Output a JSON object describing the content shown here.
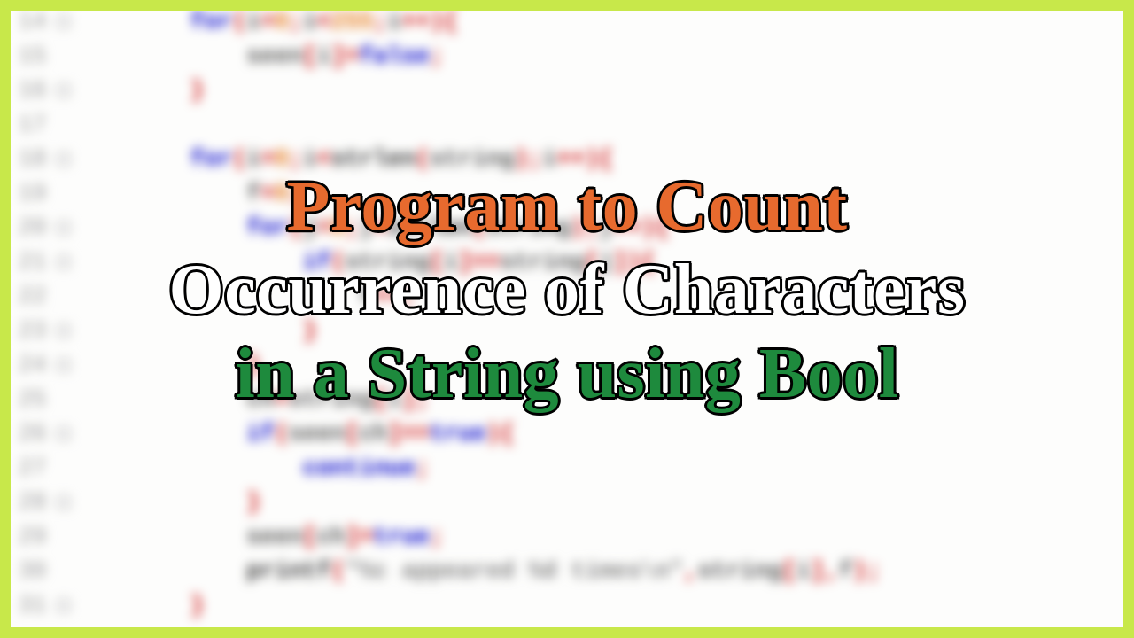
{
  "title": {
    "line1": "Program to Count",
    "line2": "Occurrence of Characters",
    "line3": "in a String using Bool"
  },
  "code": {
    "lines": [
      {
        "n": 14,
        "mark": true,
        "tokens": [
          [
            "",
            "        "
          ],
          [
            "kw",
            "for"
          ],
          [
            "op",
            "("
          ],
          [
            "id",
            "i"
          ],
          [
            "op",
            "="
          ],
          [
            "num",
            "0"
          ],
          [
            "op",
            ";"
          ],
          [
            "id",
            "i"
          ],
          [
            "op",
            "<"
          ],
          [
            "num",
            "255"
          ],
          [
            "op",
            ";"
          ],
          [
            "id",
            "i"
          ],
          [
            "op",
            "++"
          ],
          [
            "op",
            ")"
          ],
          [
            "op",
            "{"
          ]
        ]
      },
      {
        "n": 15,
        "mark": false,
        "tokens": [
          [
            "",
            "            "
          ],
          [
            "id",
            "seen"
          ],
          [
            "op",
            "["
          ],
          [
            "id",
            "i"
          ],
          [
            "op",
            "]"
          ],
          [
            "op",
            "="
          ],
          [
            "bool",
            "false"
          ],
          [
            "op",
            ";"
          ]
        ]
      },
      {
        "n": 16,
        "mark": true,
        "tokens": [
          [
            "",
            "        "
          ],
          [
            "op",
            "}"
          ]
        ]
      },
      {
        "n": 17,
        "mark": false,
        "tokens": [
          [
            "",
            ""
          ]
        ]
      },
      {
        "n": 18,
        "mark": true,
        "tokens": [
          [
            "",
            "        "
          ],
          [
            "kw",
            "for"
          ],
          [
            "op",
            "("
          ],
          [
            "id",
            "i"
          ],
          [
            "op",
            "="
          ],
          [
            "num",
            "0"
          ],
          [
            "op",
            ";"
          ],
          [
            "id",
            "i"
          ],
          [
            "op",
            "<"
          ],
          [
            "fn",
            "strlen"
          ],
          [
            "op",
            "("
          ],
          [
            "id",
            "string"
          ],
          [
            "op",
            ")"
          ],
          [
            "op",
            ";"
          ],
          [
            "id",
            "i"
          ],
          [
            "op",
            "++"
          ],
          [
            "op",
            ")"
          ],
          [
            "op",
            "{"
          ]
        ]
      },
      {
        "n": 19,
        "mark": false,
        "tokens": [
          [
            "",
            "            "
          ],
          [
            "id",
            "f"
          ],
          [
            "op",
            "="
          ],
          [
            "num",
            "0"
          ],
          [
            "op",
            ";"
          ]
        ]
      },
      {
        "n": 20,
        "mark": true,
        "tokens": [
          [
            "",
            "            "
          ],
          [
            "kw",
            "for"
          ],
          [
            "op",
            "("
          ],
          [
            "id",
            "j"
          ],
          [
            "op",
            "="
          ],
          [
            "num",
            "0"
          ],
          [
            "op",
            ";"
          ],
          [
            "id",
            "j"
          ],
          [
            "op",
            "<"
          ],
          [
            "fn",
            "strlen"
          ],
          [
            "op",
            "("
          ],
          [
            "id",
            "string"
          ],
          [
            "op",
            ")"
          ],
          [
            "op",
            ";"
          ],
          [
            "id",
            "j"
          ],
          [
            "op",
            "++"
          ],
          [
            "op",
            ")"
          ],
          [
            "op",
            "{"
          ]
        ]
      },
      {
        "n": 21,
        "mark": true,
        "tokens": [
          [
            "",
            "                "
          ],
          [
            "kw",
            "if"
          ],
          [
            "op",
            "("
          ],
          [
            "id",
            "string"
          ],
          [
            "op",
            "["
          ],
          [
            "id",
            "i"
          ],
          [
            "op",
            "]"
          ],
          [
            "op",
            "=="
          ],
          [
            "id",
            "string"
          ],
          [
            "op",
            "["
          ],
          [
            "id",
            "j"
          ],
          [
            "op",
            "]"
          ],
          [
            "op",
            ")"
          ],
          [
            "op",
            "{"
          ]
        ]
      },
      {
        "n": 22,
        "mark": false,
        "tokens": [
          [
            "",
            "                    "
          ],
          [
            "id",
            "f"
          ],
          [
            "op",
            "++;"
          ]
        ]
      },
      {
        "n": 23,
        "mark": true,
        "tokens": [
          [
            "",
            "                "
          ],
          [
            "op",
            "}"
          ]
        ]
      },
      {
        "n": 24,
        "mark": true,
        "tokens": [
          [
            "",
            "            "
          ],
          [
            "op",
            "}"
          ]
        ]
      },
      {
        "n": 25,
        "mark": false,
        "tokens": [
          [
            "",
            "            "
          ],
          [
            "id",
            "ch"
          ],
          [
            "op",
            "="
          ],
          [
            "id",
            "string"
          ],
          [
            "op",
            "["
          ],
          [
            "id",
            "i"
          ],
          [
            "op",
            "]"
          ],
          [
            "op",
            ";"
          ]
        ]
      },
      {
        "n": 26,
        "mark": true,
        "tokens": [
          [
            "",
            "            "
          ],
          [
            "kw",
            "if"
          ],
          [
            "op",
            "("
          ],
          [
            "id",
            "seen"
          ],
          [
            "op",
            "["
          ],
          [
            "id",
            "ch"
          ],
          [
            "op",
            "]"
          ],
          [
            "op",
            "=="
          ],
          [
            "bool",
            "true"
          ],
          [
            "op",
            ")"
          ],
          [
            "op",
            "{"
          ]
        ]
      },
      {
        "n": 27,
        "mark": false,
        "tokens": [
          [
            "",
            "                "
          ],
          [
            "kw",
            "continue"
          ],
          [
            "op",
            ";"
          ]
        ]
      },
      {
        "n": 28,
        "mark": true,
        "tokens": [
          [
            "",
            "            "
          ],
          [
            "op",
            "}"
          ]
        ]
      },
      {
        "n": 29,
        "mark": false,
        "tokens": [
          [
            "",
            "            "
          ],
          [
            "id",
            "seen"
          ],
          [
            "op",
            "["
          ],
          [
            "id",
            "ch"
          ],
          [
            "op",
            "]"
          ],
          [
            "op",
            "="
          ],
          [
            "bool",
            "true"
          ],
          [
            "op",
            ";"
          ]
        ]
      },
      {
        "n": 30,
        "mark": false,
        "tokens": [
          [
            "",
            "            "
          ],
          [
            "fn",
            "printf"
          ],
          [
            "op",
            "("
          ],
          [
            "str",
            "\"%c appeared %d times\\n\""
          ],
          [
            "op",
            ","
          ],
          [
            "id",
            "string"
          ],
          [
            "op",
            "["
          ],
          [
            "id",
            "i"
          ],
          [
            "op",
            "]"
          ],
          [
            "op",
            ","
          ],
          [
            "id",
            "f"
          ],
          [
            "op",
            ")"
          ],
          [
            "op",
            ";"
          ]
        ]
      },
      {
        "n": 31,
        "mark": true,
        "tokens": [
          [
            "",
            "        "
          ],
          [
            "op",
            "}"
          ]
        ]
      }
    ]
  }
}
